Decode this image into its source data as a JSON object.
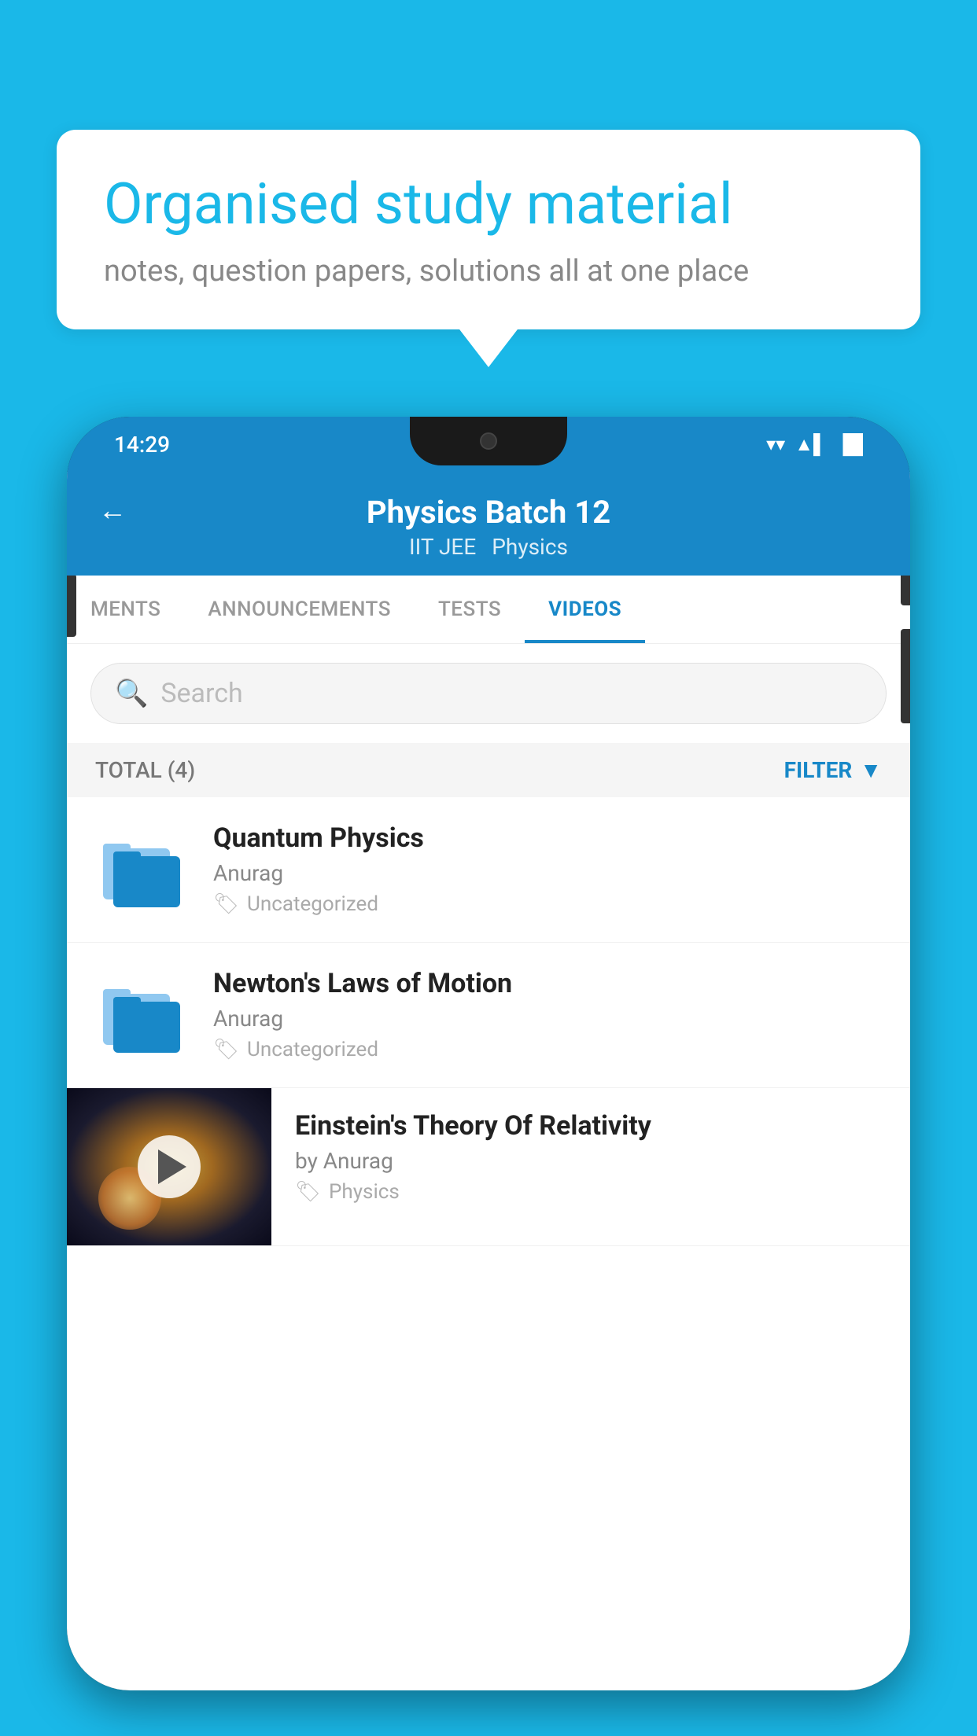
{
  "bubble": {
    "title": "Organised study material",
    "subtitle": "notes, question papers, solutions all at one place"
  },
  "status_bar": {
    "time": "14:29",
    "wifi_icon": "▼",
    "signal_icon": "▲",
    "battery_icon": "▐"
  },
  "header": {
    "back_label": "←",
    "title": "Physics Batch 12",
    "tag1": "IIT JEE",
    "tag2": "Physics"
  },
  "tabs": [
    {
      "label": "MENTS",
      "active": false
    },
    {
      "label": "ANNOUNCEMENTS",
      "active": false
    },
    {
      "label": "TESTS",
      "active": false
    },
    {
      "label": "VIDEOS",
      "active": true
    }
  ],
  "search": {
    "placeholder": "Search"
  },
  "filter_bar": {
    "total_label": "TOTAL (4)",
    "filter_label": "FILTER"
  },
  "videos": [
    {
      "title": "Quantum Physics",
      "author": "Anurag",
      "tag": "Uncategorized",
      "type": "folder"
    },
    {
      "title": "Newton's Laws of Motion",
      "author": "Anurag",
      "tag": "Uncategorized",
      "type": "folder"
    },
    {
      "title": "Einstein's Theory Of Relativity",
      "author": "by Anurag",
      "tag": "Physics",
      "type": "video"
    }
  ]
}
